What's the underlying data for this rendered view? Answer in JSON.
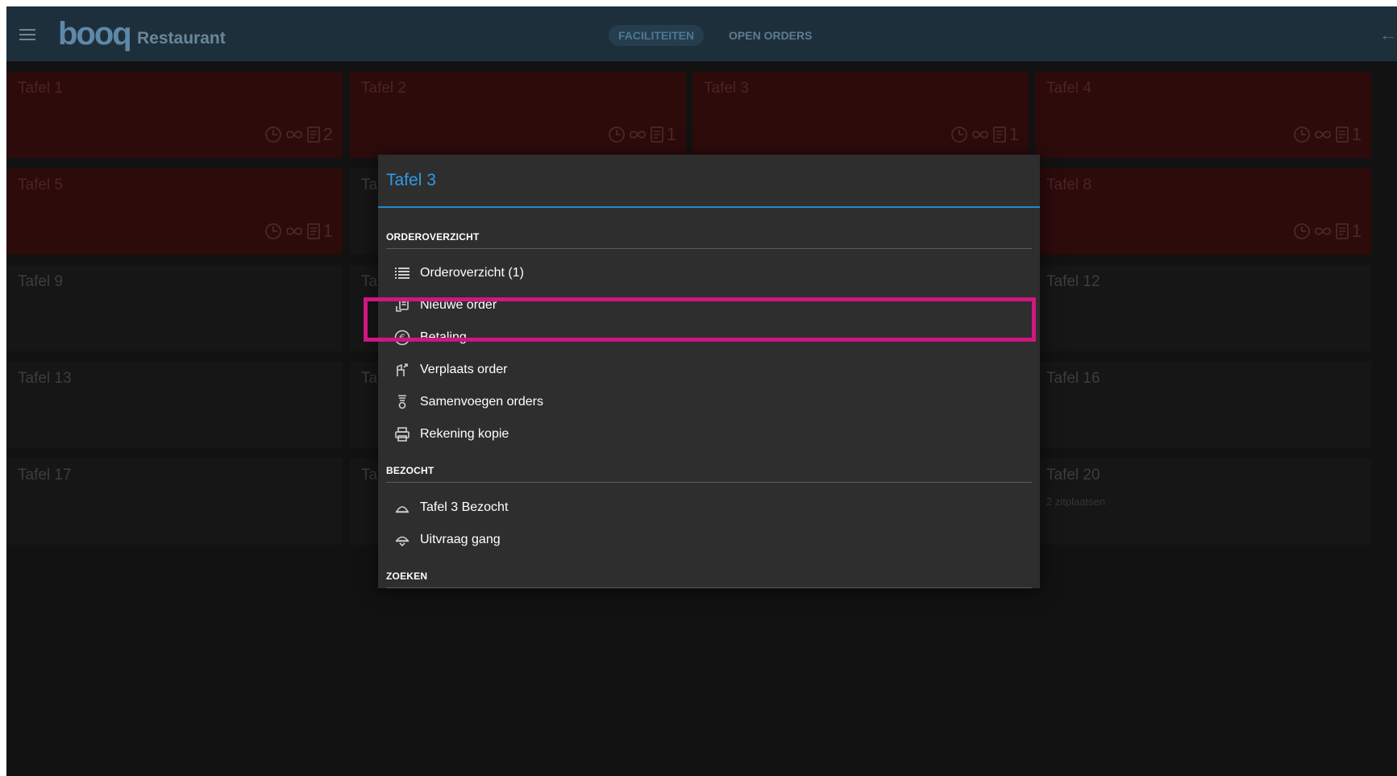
{
  "app": {
    "logo": "booq",
    "title": "Restaurant",
    "tabs": [
      {
        "label": "FACILITEITEN",
        "active": true
      },
      {
        "label": "OPEN ORDERS",
        "active": false
      }
    ]
  },
  "tables": [
    {
      "name": "Tafel 1",
      "occupied": true,
      "orders": "2"
    },
    {
      "name": "Tafel 2",
      "occupied": true,
      "orders": "1"
    },
    {
      "name": "Tafel 3",
      "occupied": true,
      "orders": "1"
    },
    {
      "name": "Tafel 4",
      "occupied": true,
      "orders": "1"
    },
    {
      "name": "Tafel 5",
      "occupied": true,
      "orders": "1"
    },
    {
      "name": "Ta",
      "occupied": false,
      "orders": ""
    },
    {
      "name": "",
      "occupied": false,
      "orders": ""
    },
    {
      "name": "Tafel 8",
      "occupied": true,
      "orders": "1"
    },
    {
      "name": "Tafel 9",
      "occupied": false,
      "orders": ""
    },
    {
      "name": "Ta",
      "occupied": false,
      "orders": ""
    },
    {
      "name": "",
      "occupied": false,
      "orders": ""
    },
    {
      "name": "Tafel 12",
      "occupied": false,
      "orders": ""
    },
    {
      "name": "Tafel 13",
      "occupied": false,
      "orders": ""
    },
    {
      "name": "Ta",
      "occupied": false,
      "orders": ""
    },
    {
      "name": "",
      "occupied": false,
      "orders": ""
    },
    {
      "name": "Tafel 16",
      "occupied": false,
      "orders": ""
    },
    {
      "name": "Tafel 17",
      "occupied": false,
      "orders": ""
    },
    {
      "name": "Ta",
      "occupied": false,
      "orders": ""
    },
    {
      "name": "",
      "occupied": false,
      "orders": ""
    },
    {
      "name": "Tafel 20",
      "occupied": false,
      "orders": "",
      "sub": "2 zitplaatsen"
    }
  ],
  "dialog": {
    "title": "Tafel 3",
    "sections": {
      "orderoverzicht": "ORDEROVERZICHT",
      "bezocht": "BEZOCHT",
      "zoeken": "ZOEKEN"
    },
    "items": {
      "orderoverzicht": "Orderoverzicht (1)",
      "nieuwe_order": "Nieuwe order",
      "betaling": "Betaling",
      "verplaats_order": "Verplaats order",
      "samenvoegen": "Samenvoegen orders",
      "rekening_kopie": "Rekening kopie",
      "bezocht": "Tafel 3 Bezocht",
      "uitvraag": "Uitvraag gang"
    },
    "highlighted_item": "Betaling"
  },
  "colors": {
    "accent": "#2f9be6",
    "highlight": "#d0167f",
    "occupied_tile": "#2d0b0b",
    "topbar": "#1e2f3c"
  }
}
